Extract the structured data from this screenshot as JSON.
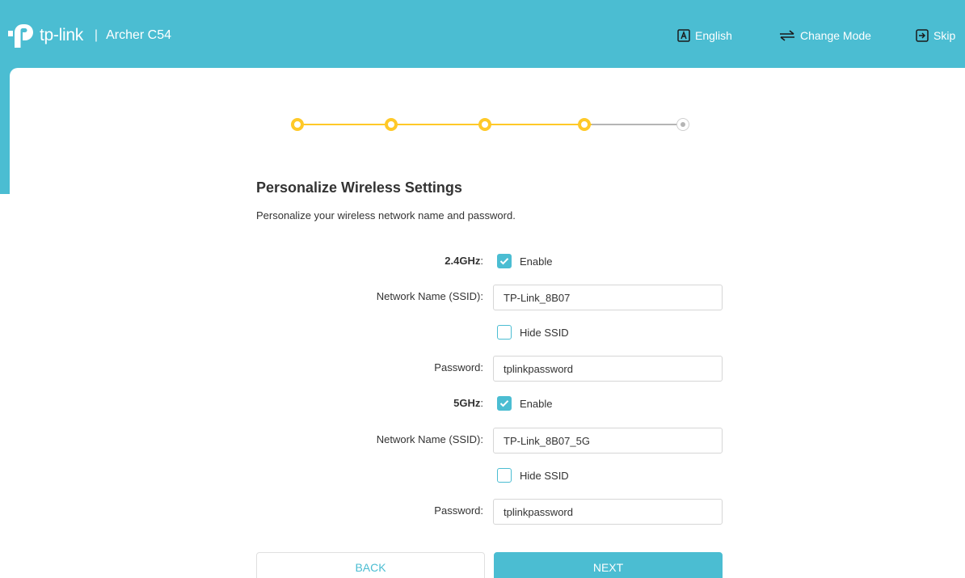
{
  "header": {
    "brand": "tp-link",
    "separator": "|",
    "model": "Archer C54",
    "nav": {
      "language": "English",
      "change_mode": "Change Mode",
      "skip": "Skip"
    }
  },
  "stepper": {
    "total_steps": 5,
    "current_step": 5,
    "completed_color": "#ffc928",
    "pending_color": "#b5b5b5"
  },
  "page": {
    "title": "Personalize Wireless Settings",
    "subtitle": "Personalize your wireless network name and password."
  },
  "band_24": {
    "label": "2.4GHz",
    "colon": ":",
    "enable_label": "Enable",
    "enabled": true,
    "ssid_label": "Network Name (SSID):",
    "ssid_value": "TP-Link_8B07",
    "hide_ssid_label": "Hide SSID",
    "hide_ssid": false,
    "password_label": "Password:",
    "password_value": "tplinkpassword"
  },
  "band_5": {
    "label": "5GHz",
    "colon": ":",
    "enable_label": "Enable",
    "enabled": true,
    "ssid_label": "Network Name (SSID):",
    "ssid_value": "TP-Link_8B07_5G",
    "hide_ssid_label": "Hide SSID",
    "hide_ssid": false,
    "password_label": "Password:",
    "password_value": "tplinkpassword"
  },
  "buttons": {
    "back": "BACK",
    "next": "NEXT"
  },
  "colors": {
    "accent": "#4bbdd2",
    "step_done": "#ffc928"
  }
}
